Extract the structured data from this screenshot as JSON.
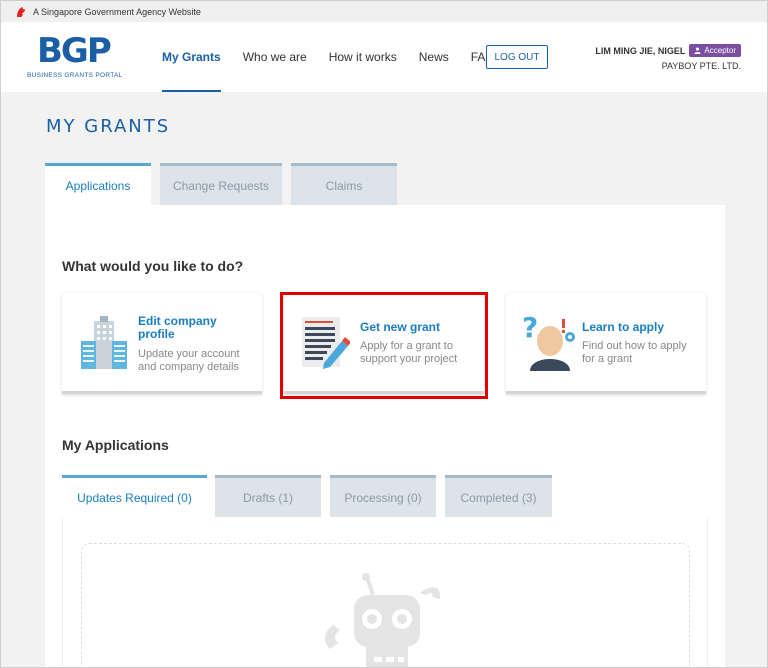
{
  "gov_banner": "A Singapore Government Agency Website",
  "logo": {
    "main": "BGP",
    "sub": "BUSINESS GRANTS PORTAL"
  },
  "nav": [
    {
      "label": "My Grants",
      "active": true
    },
    {
      "label": "Who we are",
      "active": false
    },
    {
      "label": "How it works",
      "active": false
    },
    {
      "label": "News",
      "active": false
    },
    {
      "label": "FAQ",
      "active": false
    }
  ],
  "logout_label": "LOG OUT",
  "user": {
    "name": "LIM MING JIE, NIGEL",
    "role": "Acceptor",
    "company": "PAYBOY PTE. LTD."
  },
  "page_title": "MY GRANTS",
  "tabs": [
    "Applications",
    "Change Requests",
    "Claims"
  ],
  "question": "What would you like to do?",
  "cards": [
    {
      "title": "Edit company profile",
      "desc": "Update your account and company details",
      "icon": "building-icon"
    },
    {
      "title": "Get new grant",
      "desc": "Apply for a grant to support your project",
      "icon": "document-pen-icon"
    },
    {
      "title": "Learn to apply",
      "desc": "Find out how to apply for a grant",
      "icon": "person-question-icon"
    }
  ],
  "my_applications": "My Applications",
  "sub_tabs": [
    "Updates Required (0)",
    "Drafts (1)",
    "Processing (0)",
    "Completed (3)"
  ],
  "colors": {
    "primary": "#1a5fa6",
    "accent": "#1a7dc0",
    "highlight": "#e00000",
    "badge": "#7b4ea3"
  }
}
